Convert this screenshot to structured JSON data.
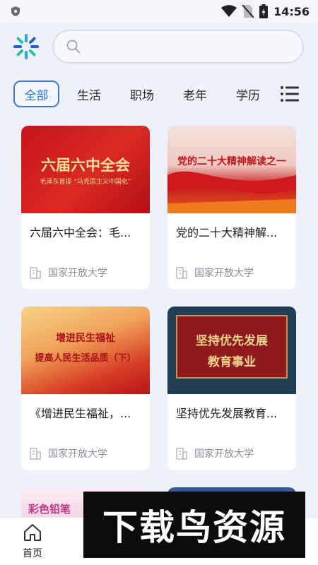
{
  "status_bar": {
    "time": "14:56"
  },
  "search": {
    "placeholder": ""
  },
  "tabs": [
    {
      "label": "全部"
    },
    {
      "label": "生活"
    },
    {
      "label": "职场"
    },
    {
      "label": "老年"
    },
    {
      "label": "学历"
    }
  ],
  "cards": [
    {
      "title": "六届六中全会：毛...",
      "source": "国家开放大学",
      "thumb_line1": "六届六中全会",
      "thumb_line2": "毛泽东首提 “马克思主义中国化”"
    },
    {
      "title": "党的二十大精神解...",
      "source": "国家开放大学",
      "thumb_line1": "党的二十大精神解读之一"
    },
    {
      "title": "《增进民生福祉，...",
      "source": "国家开放大学",
      "thumb_line1": "增进民生福祉",
      "thumb_line2": "提高人民生活品质（下）"
    },
    {
      "title": "坚持优先发展教育...",
      "source": "国家开放大学",
      "thumb_line1": "坚持优先发展",
      "thumb_line2": "教育事业"
    }
  ],
  "peek_cards": [
    {
      "thumb_text": "彩色铅笔"
    }
  ],
  "bottom_nav": {
    "home_label": "首页"
  },
  "watermark": {
    "text": "下载鸟资源"
  },
  "colors": {
    "accent": "#3d7ad4",
    "background": "#eef1f9",
    "card": "#ffffff"
  }
}
